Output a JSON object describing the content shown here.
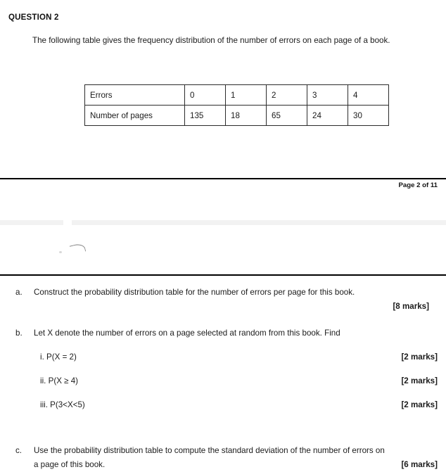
{
  "question": {
    "heading": "QUESTION 2",
    "intro": "The following table gives the frequency distribution of the number of errors on each page of a book."
  },
  "freq_table": {
    "row_labels": [
      "Errors",
      "Number of pages"
    ],
    "errors": [
      "0",
      "1",
      "2",
      "3",
      "4"
    ],
    "pages": [
      "135",
      "18",
      "65",
      "24",
      "30"
    ]
  },
  "footer": {
    "page_label": "Page 2 of 11"
  },
  "parts": {
    "a": {
      "marker": "a.",
      "text": "Construct the probability distribution table for the number of errors per page for this book.",
      "marks": "[8 marks]"
    },
    "b": {
      "marker": "b.",
      "text": "Let X denote the number of errors on a page selected at random from this book. Find",
      "items": [
        {
          "label": "i. P(X = 2)",
          "marks": "[2 marks]"
        },
        {
          "label": "ii. P(X ≥ 4)",
          "marks": "[2 marks]"
        },
        {
          "label": "iii. P(3<X<5)",
          "marks": "[2 marks]"
        }
      ]
    },
    "c": {
      "marker": "c.",
      "line1": "Use the probability distribution table to compute the standard deviation of the number of errors on",
      "line2": "a page of this book.",
      "marks": "[6 marks]"
    }
  }
}
